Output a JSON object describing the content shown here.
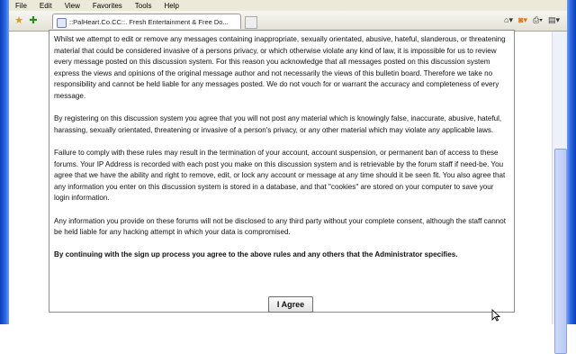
{
  "menu": {
    "items": [
      "File",
      "Edit",
      "View",
      "Favorites",
      "Tools",
      "Help"
    ]
  },
  "tab": {
    "title": "::PalHeart.Co.CC::. Fresh Entertainment & Free Do..."
  },
  "rules": {
    "paragraphs": [
      "Whilst we attempt to edit or remove any messages containing inappropriate, sexually orientated, abusive, hateful, slanderous, or threatening material that could be considered invasive of a persons privacy, or which otherwise violate any kind of law, it is impossible for us to review every message posted on this discussion system. For this reason you acknowledge that all messages posted on this discussion system express the views and opinions of the original message author and not necessarily the views of this bulletin board. Therefore we take no responsibility and cannot be held liable for any messages posted. We do not vouch for or warrant the accuracy and completeness of every message.",
      "By registering on this discussion system you agree that you will not post any material which is knowingly false, inaccurate, abusive, hateful, harassing, sexually orientated, threatening or invasive of a person's privacy, or any other material which may violate any applicable laws.",
      "Failure to comply with these rules may result in the termination of your account, account suspension, or permanent ban of access to these forums. Your IP Address is recorded with each post you make on this discussion system and is retrievable by the forum staff if need-be. You agree that we have the ability and right to remove, edit, or lock any account or message at any time should it be seen fit. You also agree that any information you enter on this discussion system is stored in a database, and that \"cookies\" are stored on your computer to save your login information.",
      "Any information you provide on these forums will not be disclosed to any third party without your complete consent, although the staff cannot be held liable for any hacking attempt in which your data is compromised."
    ],
    "final_bold": "By continuing with the sign up process you agree to the above rules and any others that the Administrator specifies."
  },
  "agree_button": {
    "label": "I Agree"
  },
  "colors": {
    "window_frame": "#2a68e6",
    "menubar_bg": "#ece9d8",
    "box_border": "#8c8c8c"
  },
  "icons": [
    "back-icon",
    "forward-icon",
    "favorites-star-icon",
    "add-favorite-icon",
    "home-icon",
    "rss-icon",
    "print-icon",
    "page-icon"
  ]
}
